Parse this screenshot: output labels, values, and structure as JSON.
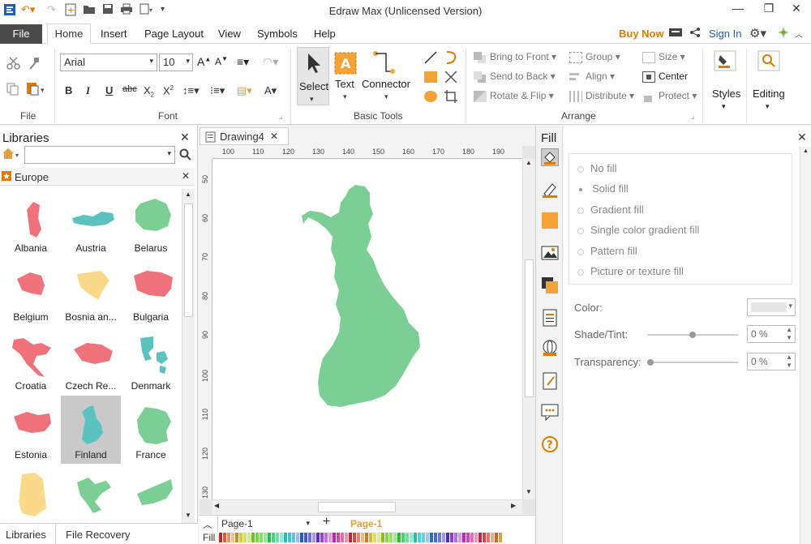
{
  "window": {
    "title": "Edraw Max (Unlicensed Version)",
    "minimize_label": "—",
    "restore_label": "❐",
    "close_label": "✕"
  },
  "tabs": {
    "file": "File",
    "home": "Home",
    "insert": "Insert",
    "page_layout": "Page Layout",
    "view": "View",
    "symbols": "Symbols",
    "help": "Help",
    "buy_now": "Buy Now",
    "sign_in": "Sign In"
  },
  "ribbon": {
    "groups": {
      "file": "File",
      "font": "Font",
      "basic_tools": "Basic Tools",
      "arrange": "Arrange"
    },
    "font_name": "Arial",
    "font_size": "10",
    "tools": {
      "select": "Select",
      "text": "Text",
      "connector": "Connector"
    },
    "arrange": {
      "bring_to_front": "Bring to Front",
      "send_to_back": "Send to Back",
      "rotate_flip": "Rotate & Flip",
      "group": "Group",
      "align": "Align",
      "distribute": "Distribute",
      "size": "Size",
      "center": "Center",
      "protect": "Protect"
    },
    "styles": "Styles",
    "editing": "Editing"
  },
  "libraries": {
    "title": "Libraries",
    "category": "Europe",
    "items": [
      {
        "label": "Albania",
        "color": "#f0727a"
      },
      {
        "label": "Austria",
        "color": "#5cc2c0"
      },
      {
        "label": "Belarus",
        "color": "#7ccf94"
      },
      {
        "label": "Belgium",
        "color": "#f0727a"
      },
      {
        "label": "Bosnia an...",
        "color": "#fbd98a"
      },
      {
        "label": "Bulgaria",
        "color": "#f0727a"
      },
      {
        "label": "Croatia",
        "color": "#f0727a"
      },
      {
        "label": "Czech Re...",
        "color": "#f0727a"
      },
      {
        "label": "Denmark",
        "color": "#5cc2c0"
      },
      {
        "label": "Estonia",
        "color": "#f0727a"
      },
      {
        "label": "Finland",
        "color": "#5cc2c0"
      },
      {
        "label": "France",
        "color": "#7ccf94"
      },
      {
        "label": "",
        "color": "#fbd98a"
      },
      {
        "label": "",
        "color": "#7ccf94"
      },
      {
        "label": "",
        "color": "#7ccf94"
      }
    ],
    "footer_tabs": [
      "Libraries",
      "File Recovery"
    ]
  },
  "document": {
    "tab_name": "Drawing4",
    "ruler_h": [
      "100",
      "110",
      "120",
      "130",
      "140",
      "150",
      "160",
      "170",
      "180",
      "190"
    ],
    "ruler_v": [
      "50",
      "60",
      "70",
      "80",
      "90",
      "100",
      "110",
      "120",
      "130"
    ],
    "shape_color": "#7ccf94",
    "page_select": "Page-1",
    "page_tab": "Page-1",
    "fill_label": "Fill"
  },
  "fill_panel": {
    "title": "Fill",
    "options": [
      "No fill",
      "Solid fill",
      "Gradient fill",
      "Single color gradient fill",
      "Pattern fill",
      "Picture or texture fill"
    ],
    "selected": "Solid fill",
    "color_label": "Color:",
    "shade_label": "Shade/Tint:",
    "shade_value": "0 %",
    "transparency_label": "Transparency:",
    "transparency_value": "0 %"
  },
  "colors": {
    "accent_orange": "#e07b00",
    "file_tab": "#4a4a4a",
    "link_blue": "#1e5fb4"
  }
}
